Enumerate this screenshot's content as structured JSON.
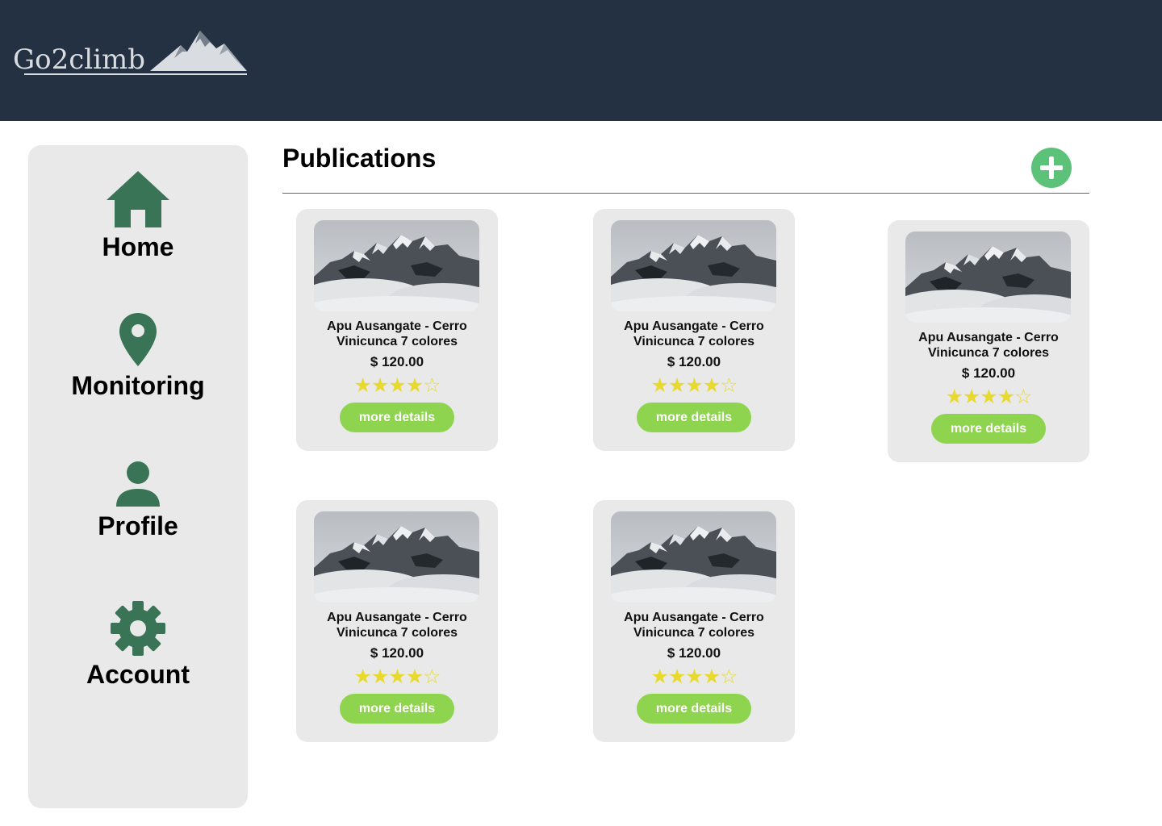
{
  "app": {
    "logo_text": "Go2climb",
    "colors": {
      "header": "#233143",
      "accent_green": "#3a7456",
      "add_button": "#5cc27a",
      "details_button": "#8fd44e",
      "star": "#e8d92f"
    }
  },
  "sidebar": {
    "items": [
      {
        "label": "Home",
        "icon": "home-icon"
      },
      {
        "label": "Monitoring",
        "icon": "location-pin-icon"
      },
      {
        "label": "Profile",
        "icon": "user-icon"
      },
      {
        "label": "Account",
        "icon": "gear-icon"
      }
    ]
  },
  "main": {
    "title": "Publications",
    "add_icon": "plus-icon",
    "cards": [
      {
        "name_line1": "Apu Ausangate - Cerro",
        "name_line2": "Vinicunca 7 colores",
        "price": "$ 120.00",
        "rating": 4,
        "rating_max": 5,
        "button": "more details"
      },
      {
        "name_line1": "Apu Ausangate - Cerro",
        "name_line2": "Vinicunca 7 colores",
        "price": "$ 120.00",
        "rating": 4,
        "rating_max": 5,
        "button": "more details"
      },
      {
        "name_line1": "Apu Ausangate - Cerro",
        "name_line2": "Vinicunca 7 colores",
        "price": "$ 120.00",
        "rating": 4,
        "rating_max": 5,
        "button": "more details"
      },
      {
        "name_line1": "Apu Ausangate - Cerro",
        "name_line2": "Vinicunca 7 colores",
        "price": "$ 120.00",
        "rating": 4,
        "rating_max": 5,
        "button": "more details"
      },
      {
        "name_line1": "Apu Ausangate - Cerro",
        "name_line2": "Vinicunca 7 colores",
        "price": "$ 120.00",
        "rating": 4,
        "rating_max": 5,
        "button": "more details"
      }
    ]
  }
}
